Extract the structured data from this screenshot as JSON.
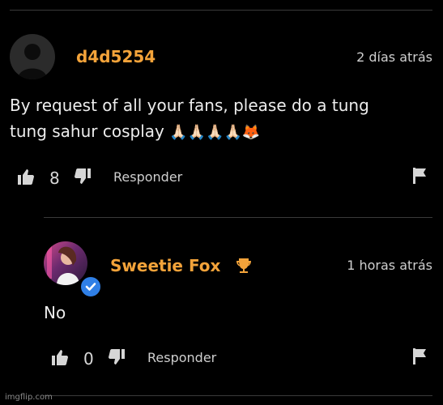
{
  "comment": {
    "username": "d4d5254",
    "time": "2 días atrás",
    "text_line1": "By request of all your fans, please do a tung",
    "text_line2": "tung sahur cosplay",
    "emojis": "🙏🏻🙏🏻🙏🏻🙏🏻🦊",
    "likes": "8",
    "reply_label": "Responder"
  },
  "reply": {
    "username": "Sweetie Fox",
    "time": "1 horas atrás",
    "text": "No",
    "likes": "0",
    "reply_label": "Responder"
  },
  "watermark": "imgflip.com",
  "colors": {
    "background": "#000000",
    "username": "#f3a33a",
    "verified": "#2f7fe6",
    "trophy": "#f3a33a"
  }
}
